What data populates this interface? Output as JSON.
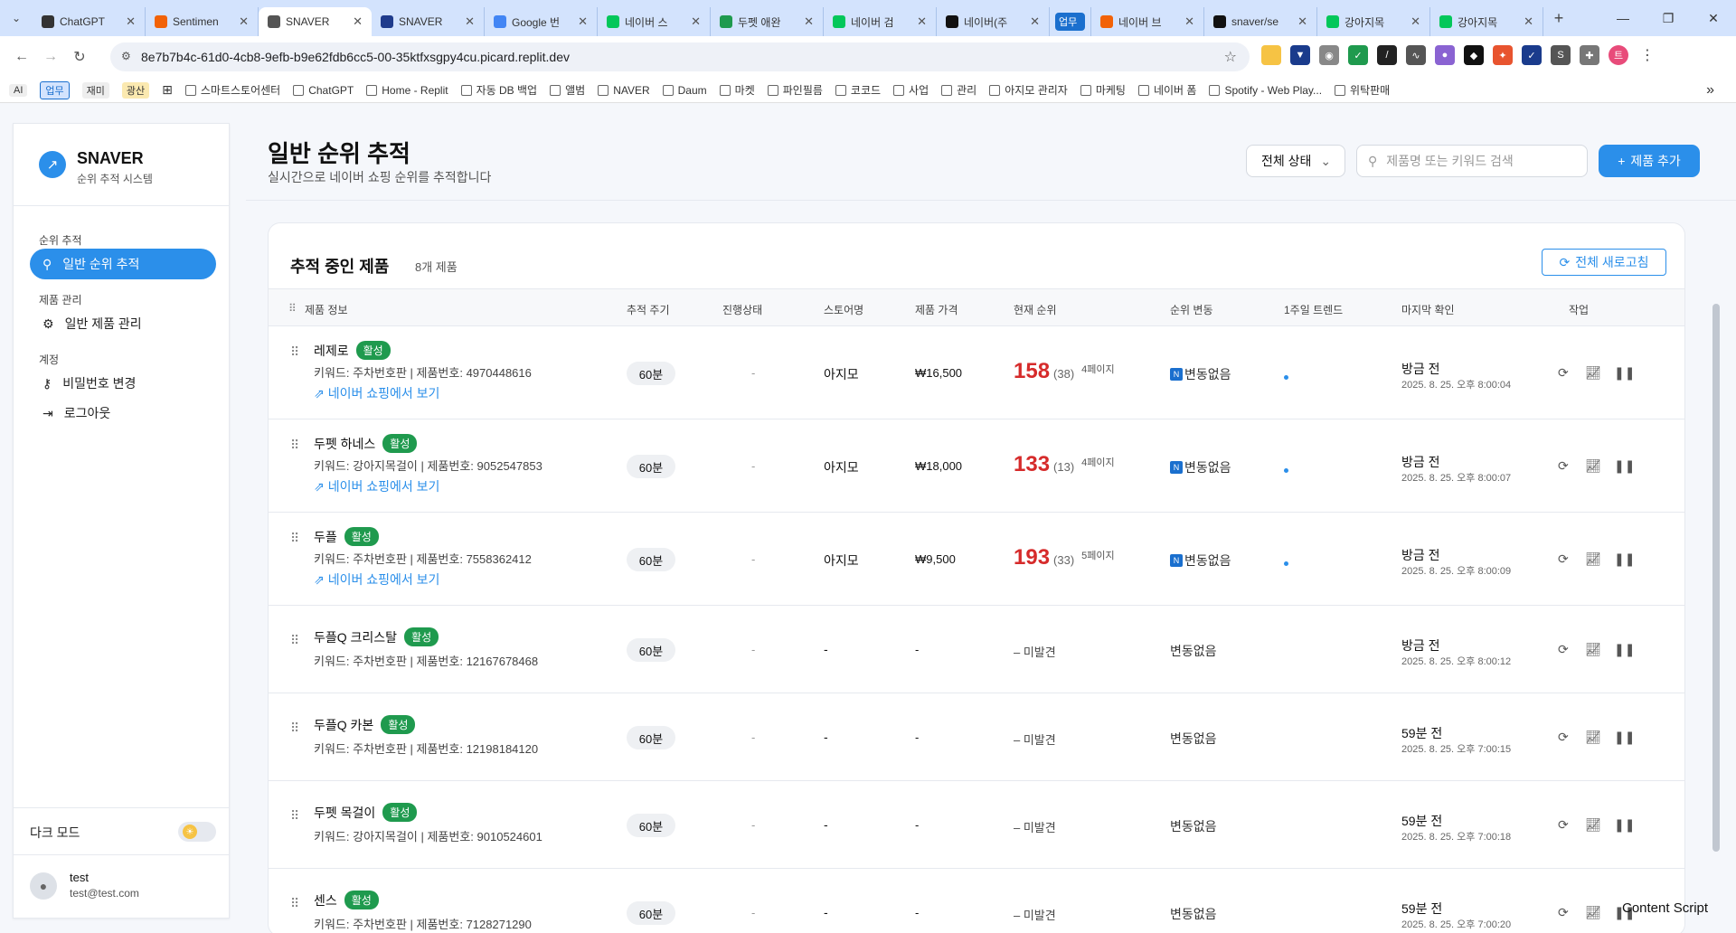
{
  "browser": {
    "tabs": [
      {
        "title": "ChatGPT",
        "icon": "openai-icon",
        "color": "#333333"
      },
      {
        "title": "Sentimen",
        "icon": "replit-icon",
        "color": "#f26207"
      },
      {
        "title": "SNAVER",
        "icon": "globe-icon",
        "color": "#555555",
        "active": true
      },
      {
        "title": "SNAVER",
        "icon": "ps-icon",
        "color": "#1f3b8c"
      },
      {
        "title": "Google 번",
        "icon": "translate-icon",
        "color": "#4285f4"
      },
      {
        "title": "네이버 스",
        "icon": "naver-store-icon",
        "color": "#03c75a"
      },
      {
        "title": "두펫 애완",
        "icon": "w-icon",
        "color": "#1f9a4e"
      },
      {
        "title": "네이버 검",
        "icon": "naver-icon",
        "color": "#03c75a"
      },
      {
        "title": "네이버(주",
        "icon": "n-icon",
        "color": "#111111"
      },
      {
        "title": "업무",
        "icon": "group-icon",
        "color": "#1a6fce",
        "group": true
      },
      {
        "title": "네이버 브",
        "icon": "b-icon",
        "color": "#f26207"
      },
      {
        "title": "snaver/se",
        "icon": "github-icon",
        "color": "#111111"
      },
      {
        "title": "강아지목",
        "icon": "naver-icon",
        "color": "#03c75a"
      },
      {
        "title": "강아지목",
        "icon": "naver-icon",
        "color": "#03c75a"
      }
    ],
    "url": "8e7b7b4c-61d0-4cb8-9efb-b9e62fdb6cc5-00-35ktfxsgpy4cu.picard.replit.dev",
    "bookmarks": [
      "AI",
      "업무",
      "재미",
      "광산",
      "스마트스토어센터",
      "ChatGPT",
      "Home - Replit",
      "자동 DB 백업",
      "앨범",
      "NAVER",
      "Daum",
      "마켓",
      "파인필름",
      "코코드",
      "사업",
      "관리",
      "아지모 관리자",
      "마케팅",
      "네이버 폼",
      "Spotify - Web Play...",
      "위탁판매"
    ]
  },
  "sidebar": {
    "brand": "SNAVER",
    "brand_sub": "순위 추적 시스템",
    "group_rank": "순위 추적",
    "item_rank": "일반 순위 추적",
    "group_product": "제품 관리",
    "item_product": "일반 제품 관리",
    "group_account": "계정",
    "item_password": "비밀번호 변경",
    "item_logout": "로그아웃",
    "dark_mode": "다크 모드",
    "user_name": "test",
    "user_email": "test@test.com"
  },
  "header": {
    "title": "일반 순위 추적",
    "subtitle": "실시간으로 네이버 쇼핑 순위를 추적합니다",
    "status_select": "전체 상태",
    "search_placeholder": "제품명 또는 키워드 검색",
    "add_button": "제품 추가"
  },
  "card": {
    "title": "추적 중인 제품",
    "count": "8개 제품",
    "refresh_all": "전체 새로고침",
    "columns": [
      "제품 정보",
      "추적 주기",
      "진행상태",
      "스토어명",
      "제품 가격",
      "현재 순위",
      "순위 변동",
      "1주일 트렌드",
      "마지막 확인",
      "작업"
    ],
    "rows": [
      {
        "name": "레제로",
        "status": "활성",
        "keyword": "키워드: 주차번호판 | 제품번호: 4970448616",
        "link": "네이버 쇼핑에서 보기",
        "cycle": "60분",
        "progress": "-",
        "store": "아지모",
        "price": "₩16,500",
        "rank": "158",
        "rank_sub": "(38)",
        "page": "4페이지",
        "change": "변동없음",
        "last": "방금 전",
        "last_date": "2025. 8. 25. 오후 8:00:04"
      },
      {
        "name": "두펫 하네스",
        "status": "활성",
        "keyword": "키워드: 강아지목걸이 | 제품번호: 9052547853",
        "link": "네이버 쇼핑에서 보기",
        "cycle": "60분",
        "progress": "-",
        "store": "아지모",
        "price": "₩18,000",
        "rank": "133",
        "rank_sub": "(13)",
        "page": "4페이지",
        "change": "변동없음",
        "last": "방금 전",
        "last_date": "2025. 8. 25. 오후 8:00:07"
      },
      {
        "name": "두플",
        "status": "활성",
        "keyword": "키워드: 주차번호판 | 제품번호: 7558362412",
        "link": "네이버 쇼핑에서 보기",
        "cycle": "60분",
        "progress": "-",
        "store": "아지모",
        "price": "₩9,500",
        "rank": "193",
        "rank_sub": "(33)",
        "page": "5페이지",
        "change": "변동없음",
        "last": "방금 전",
        "last_date": "2025. 8. 25. 오후 8:00:09"
      },
      {
        "name": "두플Q 크리스탈",
        "status": "활성",
        "keyword": "키워드: 주차번호판 | 제품번호: 12167678468",
        "cycle": "60분",
        "progress": "-",
        "store": "-",
        "price": "-",
        "rank_missing": "미발견",
        "change": "변동없음",
        "last": "방금 전",
        "last_date": "2025. 8. 25. 오후 8:00:12"
      },
      {
        "name": "두플Q 카본",
        "status": "활성",
        "keyword": "키워드: 주차번호판 | 제품번호: 12198184120",
        "cycle": "60분",
        "progress": "-",
        "store": "-",
        "price": "-",
        "rank_missing": "미발견",
        "change": "변동없음",
        "last": "59분 전",
        "last_date": "2025. 8. 25. 오후 7:00:15"
      },
      {
        "name": "두펫 목걸이",
        "status": "활성",
        "keyword": "키워드: 강아지목걸이 | 제품번호: 9010524601",
        "cycle": "60분",
        "progress": "-",
        "store": "-",
        "price": "-",
        "rank_missing": "미발견",
        "change": "변동없음",
        "last": "59분 전",
        "last_date": "2025. 8. 25. 오후 7:00:18"
      },
      {
        "name": "센스",
        "status": "활성",
        "keyword": "키워드: 주차번호판 | 제품번호: 7128271290",
        "cycle": "60분",
        "progress": "-",
        "store": "-",
        "price": "-",
        "rank_missing": "미발견",
        "change": "변동없음",
        "last": "59분 전",
        "last_date": "2025. 8. 25. 오후 7:00:20"
      }
    ]
  },
  "overlay": {
    "content_script": "Content Script"
  }
}
